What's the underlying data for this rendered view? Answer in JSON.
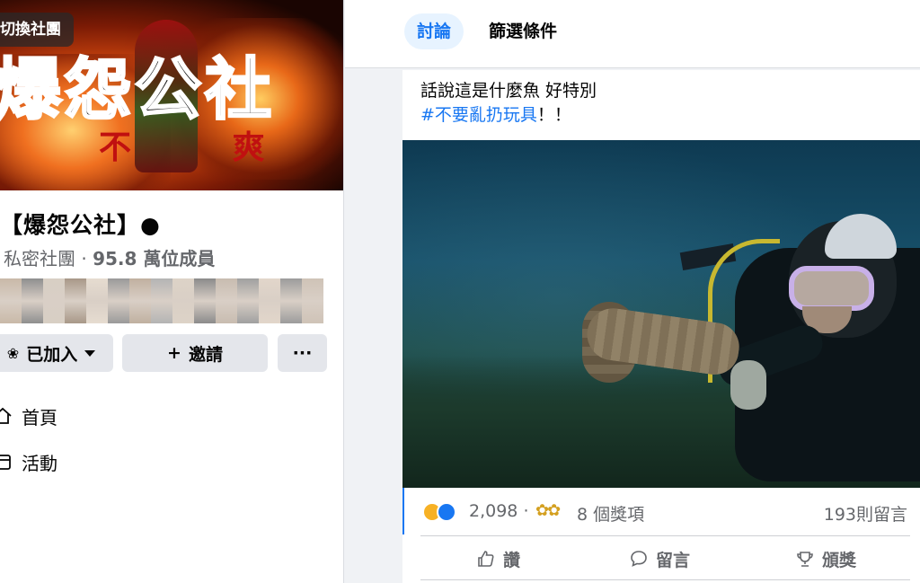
{
  "sidebar": {
    "cover": {
      "switch_label": "切換社團",
      "title_art": "爆怨公社",
      "subtitle_art": "不  爽"
    },
    "group_name": "【爆怨公社】●",
    "privacy": "私密社團",
    "separator": "·",
    "member_count": "95.8 萬位成員",
    "member_avatars_colors": [
      "#c9b9a8",
      "#8f8f8f",
      "#d8cfc4",
      "#a89888",
      "#e6dcd0",
      "#9a9a9a",
      "#c0b0a0",
      "#b4b4b4",
      "#ddd3c7",
      "#8b8b8b",
      "#c8bcb0",
      "#a0a0a0",
      "#e2d6ca",
      "#9c9c9c",
      "#cfc3b7"
    ],
    "buttons": {
      "joined": "已加入",
      "invite": "邀請",
      "more": "···"
    },
    "nav": [
      {
        "label": "首頁",
        "icon": "home-icon"
      },
      {
        "label": "活動",
        "icon": "calendar-icon"
      }
    ]
  },
  "topbar": {
    "tabs": [
      {
        "label": "討論",
        "active": true
      },
      {
        "label": "篩選條件",
        "active": false
      }
    ]
  },
  "post": {
    "text_line1": "話說這是什麼魚 好特別",
    "hashtag": "#不要亂扔玩具",
    "text_suffix": "！！",
    "photo_icon": "underwater-diver-photo",
    "reactions": {
      "count": "2,098",
      "dot": "·",
      "awards": "8 個獎項",
      "comments": "193則留言"
    },
    "actions": {
      "like": "讚",
      "comment": "留言",
      "award": "頒獎"
    }
  },
  "colors": {
    "accent": "#1877f2",
    "secondary_text": "#65676b",
    "button_bg": "#e4e6eb",
    "page_bg": "#f0f2f5"
  }
}
